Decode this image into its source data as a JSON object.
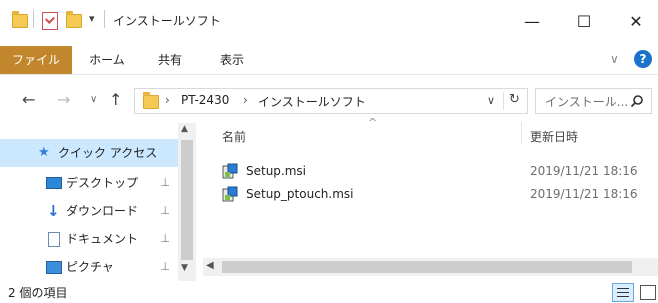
{
  "window": {
    "title": "インストールソフト",
    "minimize_glyph": "—",
    "maximize_glyph": "☐",
    "close_glyph": "✕"
  },
  "ribbon": {
    "tabs": [
      {
        "label": "ファイル",
        "active": true
      },
      {
        "label": "ホーム",
        "active": false
      },
      {
        "label": "共有",
        "active": false
      },
      {
        "label": "表示",
        "active": false
      }
    ],
    "help_glyph": "?",
    "expand_glyph": "∨"
  },
  "address": {
    "breadcrumb": [
      "PT-2430",
      "インストールソフト"
    ],
    "separator": "›",
    "search_placeholder": "インストール... ",
    "refresh_glyph": "↻",
    "dropdown_glyph": "∨"
  },
  "nav": {
    "back": "←",
    "forward": "→",
    "recent": "∨",
    "up": "↑"
  },
  "sidebar": {
    "items": [
      {
        "label": "クイック アクセス",
        "icon": "star-icon",
        "selected": true,
        "pinned": false
      },
      {
        "label": "デスクトップ",
        "icon": "desktop-icon",
        "selected": false,
        "pinned": true
      },
      {
        "label": "ダウンロード",
        "icon": "download-icon",
        "selected": false,
        "pinned": true
      },
      {
        "label": "ドキュメント",
        "icon": "document-icon",
        "selected": false,
        "pinned": true
      },
      {
        "label": "ピクチャ",
        "icon": "pictures-icon",
        "selected": false,
        "pinned": true
      }
    ],
    "pin_glyph": "📌"
  },
  "columns": {
    "name": "名前",
    "date": "更新日時",
    "sort_glyph": "^"
  },
  "files": [
    {
      "name": "Setup.msi",
      "date": "2019/11/21 18:16"
    },
    {
      "name": "Setup_ptouch.msi",
      "date": "2019/11/21 18:16"
    }
  ],
  "status": {
    "item_count": "2 個の項目"
  },
  "colors": {
    "accent_file_tab": "#c2862d",
    "selection": "#cce8ff",
    "help_blue": "#1a73c9"
  }
}
